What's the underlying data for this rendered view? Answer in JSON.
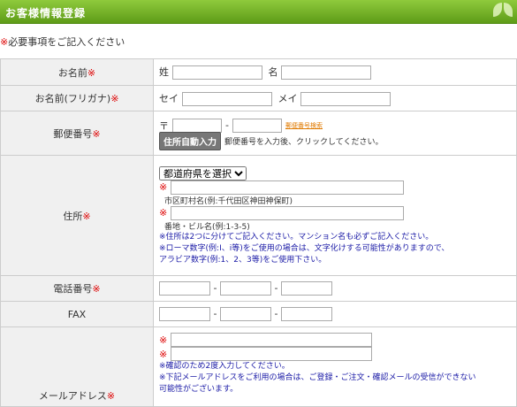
{
  "header": {
    "title": "お客様情報登録"
  },
  "notice": {
    "mark": "※",
    "text": "必要事項をご記入ください"
  },
  "fields": {
    "name": {
      "label": "お名前",
      "mark": "※",
      "last_label": "姓",
      "first_label": "名"
    },
    "kana": {
      "label": "お名前(フリガナ)",
      "mark": "※",
      "last_label": "セイ",
      "first_label": "メイ"
    },
    "postal": {
      "label": "郵便番号",
      "mark": "※",
      "prefix": "〒",
      "dash": "-",
      "search_link": "郵便番号検索",
      "auto_button": "住所自動入力",
      "hint": "郵便番号を入力後、クリックしてください。"
    },
    "address": {
      "label": "住所",
      "mark": "※",
      "pref_select": "都道府県を選択",
      "city_hint": "市区町村名(例:千代田区神田神保町)",
      "street_hint": "番地・ビル名(例:1-3-5)",
      "note1": "※住所は2つに分けてご記入ください。マンション名も必ずご記入ください。",
      "note2": "※ローマ数字(例:Ⅰ、ⅰ等)をご使用の場合は、文字化けする可能性がありますので、",
      "note3": "アラビア数字(例:1、2、3等)をご使用下さい。"
    },
    "phone": {
      "label": "電話番号",
      "mark": "※",
      "dash": "-"
    },
    "fax": {
      "label": "FAX",
      "dash": "-"
    },
    "email": {
      "label": "メールアドレス",
      "mark": "※",
      "note1": "※確認のため2度入力してください。",
      "note2": "※下記メールアドレスをご利用の場合は、ご登録・ご注文・確認メールの受信ができない",
      "note3": "可能性がございます。"
    }
  },
  "colors": {
    "header_green": "#6aac22",
    "required_red": "#dd0000",
    "note_blue": "#1a1aa6",
    "label_bg": "#f0f0f0"
  }
}
